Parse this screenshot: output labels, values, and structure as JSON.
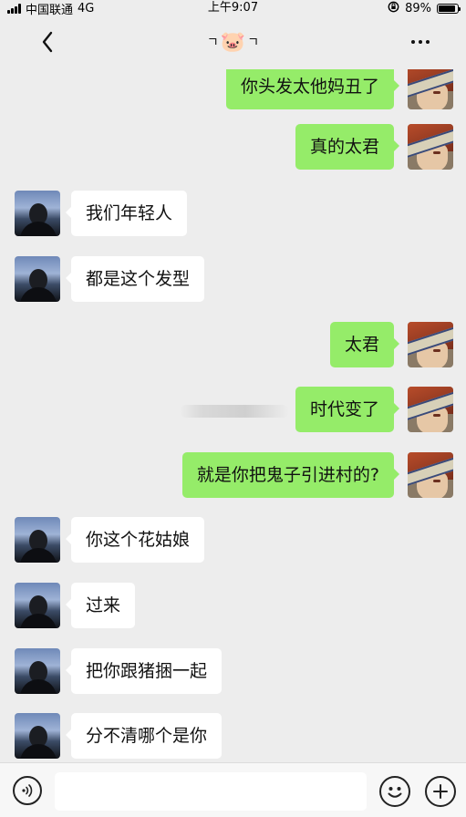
{
  "status_bar": {
    "carrier": "中国联通",
    "network": "4G",
    "time": "上午9:07",
    "battery_percent": "89%",
    "battery_level": 0.89,
    "icons": [
      "signal-icon",
      "orientation-lock-icon",
      "battery-icon"
    ]
  },
  "nav": {
    "back_icon": "chevron-left-icon",
    "title_left": "ㄱ",
    "title_emoji": "🐷",
    "title_right": "ㄱ",
    "more_icon": "more-dots-icon"
  },
  "messages": [
    {
      "side": "right",
      "text": "你头发太他妈丑了"
    },
    {
      "side": "right",
      "text": "真的太君"
    },
    {
      "side": "left",
      "text": "我们年轻人"
    },
    {
      "side": "left",
      "text": "都是这个发型"
    },
    {
      "side": "right",
      "text": "太君"
    },
    {
      "side": "right",
      "text": "时代变了"
    },
    {
      "side": "right",
      "text": "就是你把鬼子引进村的?"
    },
    {
      "side": "left",
      "text": " 你这个花姑娘"
    },
    {
      "side": "left",
      "text": "过来"
    },
    {
      "side": "left",
      "text": "把你跟猪捆一起"
    },
    {
      "side": "left",
      "text": "分不清哪个是你"
    }
  ],
  "input_bar": {
    "voice_icon": "voice-icon",
    "message_value": "",
    "emoji_icon": "emoji-icon",
    "plus_icon": "plus-icon"
  },
  "colors": {
    "background": "#ededed",
    "sent_bubble": "#95ec69",
    "received_bubble": "#ffffff"
  }
}
